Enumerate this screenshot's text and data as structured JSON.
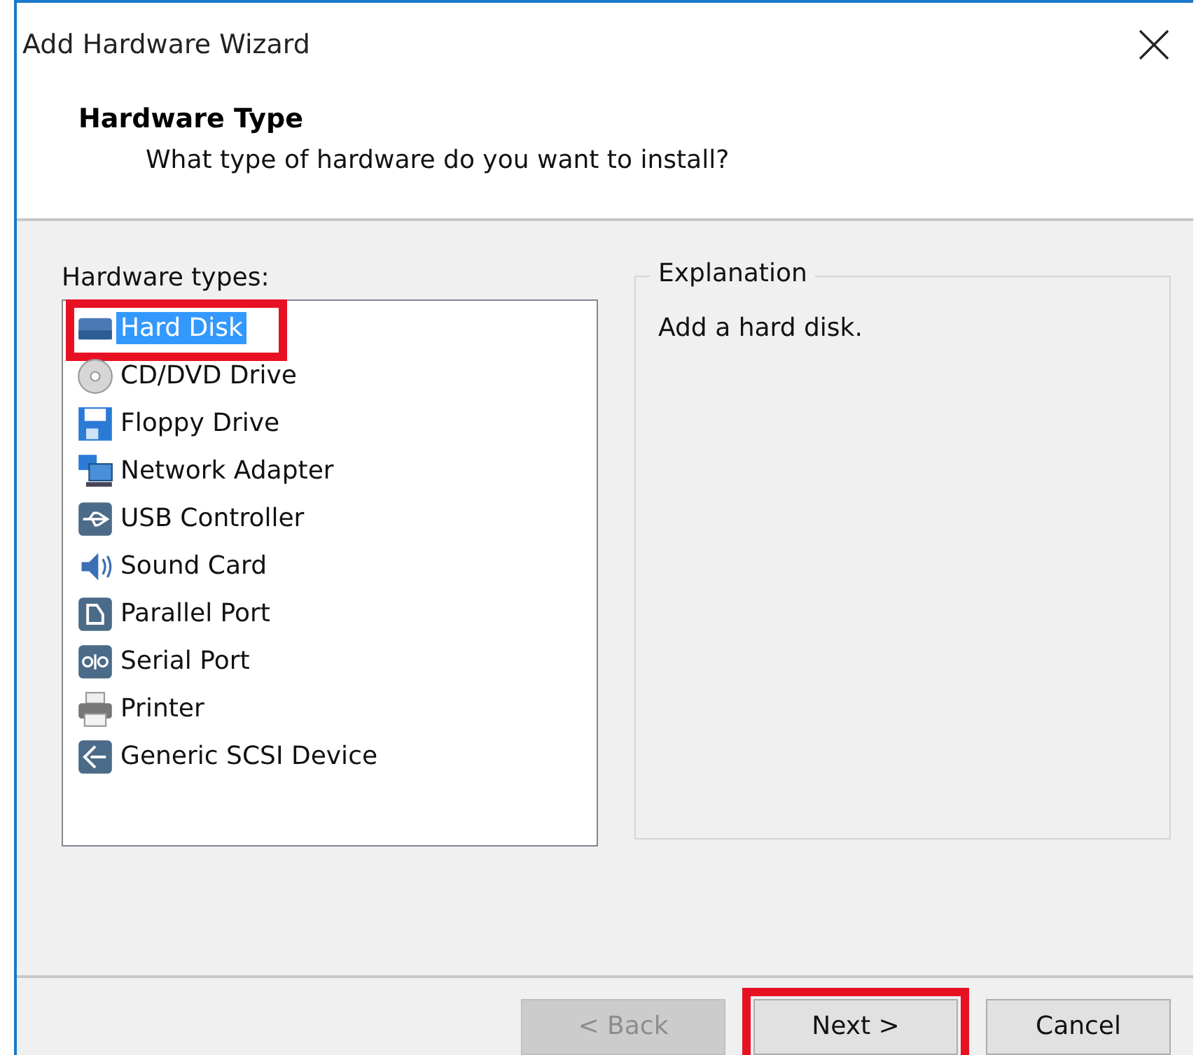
{
  "window": {
    "title": "Add Hardware Wizard"
  },
  "header": {
    "title": "Hardware Type",
    "subtitle": "What type of hardware do you want to install?"
  },
  "hardware_types": {
    "label": "Hardware types:",
    "items": [
      {
        "label": "Hard Disk",
        "kind": "disk",
        "selected": true,
        "highlighted": true
      },
      {
        "label": "CD/DVD Drive",
        "kind": "cd",
        "selected": false,
        "highlighted": false
      },
      {
        "label": "Floppy Drive",
        "kind": "floppy",
        "selected": false,
        "highlighted": false
      },
      {
        "label": "Network Adapter",
        "kind": "network",
        "selected": false,
        "highlighted": false
      },
      {
        "label": "USB Controller",
        "kind": "usb",
        "selected": false,
        "highlighted": false
      },
      {
        "label": "Sound Card",
        "kind": "sound",
        "selected": false,
        "highlighted": false
      },
      {
        "label": "Parallel Port",
        "kind": "parallel",
        "selected": false,
        "highlighted": false
      },
      {
        "label": "Serial Port",
        "kind": "serial",
        "selected": false,
        "highlighted": false
      },
      {
        "label": "Printer",
        "kind": "printer",
        "selected": false,
        "highlighted": false
      },
      {
        "label": "Generic SCSI Device",
        "kind": "scsi",
        "selected": false,
        "highlighted": false
      }
    ]
  },
  "explanation": {
    "title": "Explanation",
    "text": "Add a hard disk."
  },
  "buttons": [
    {
      "label": "< Back",
      "disabled": true,
      "highlighted": false
    },
    {
      "label": "Next >",
      "disabled": false,
      "highlighted": true
    },
    {
      "label": "Cancel",
      "disabled": false,
      "highlighted": false
    }
  ]
}
